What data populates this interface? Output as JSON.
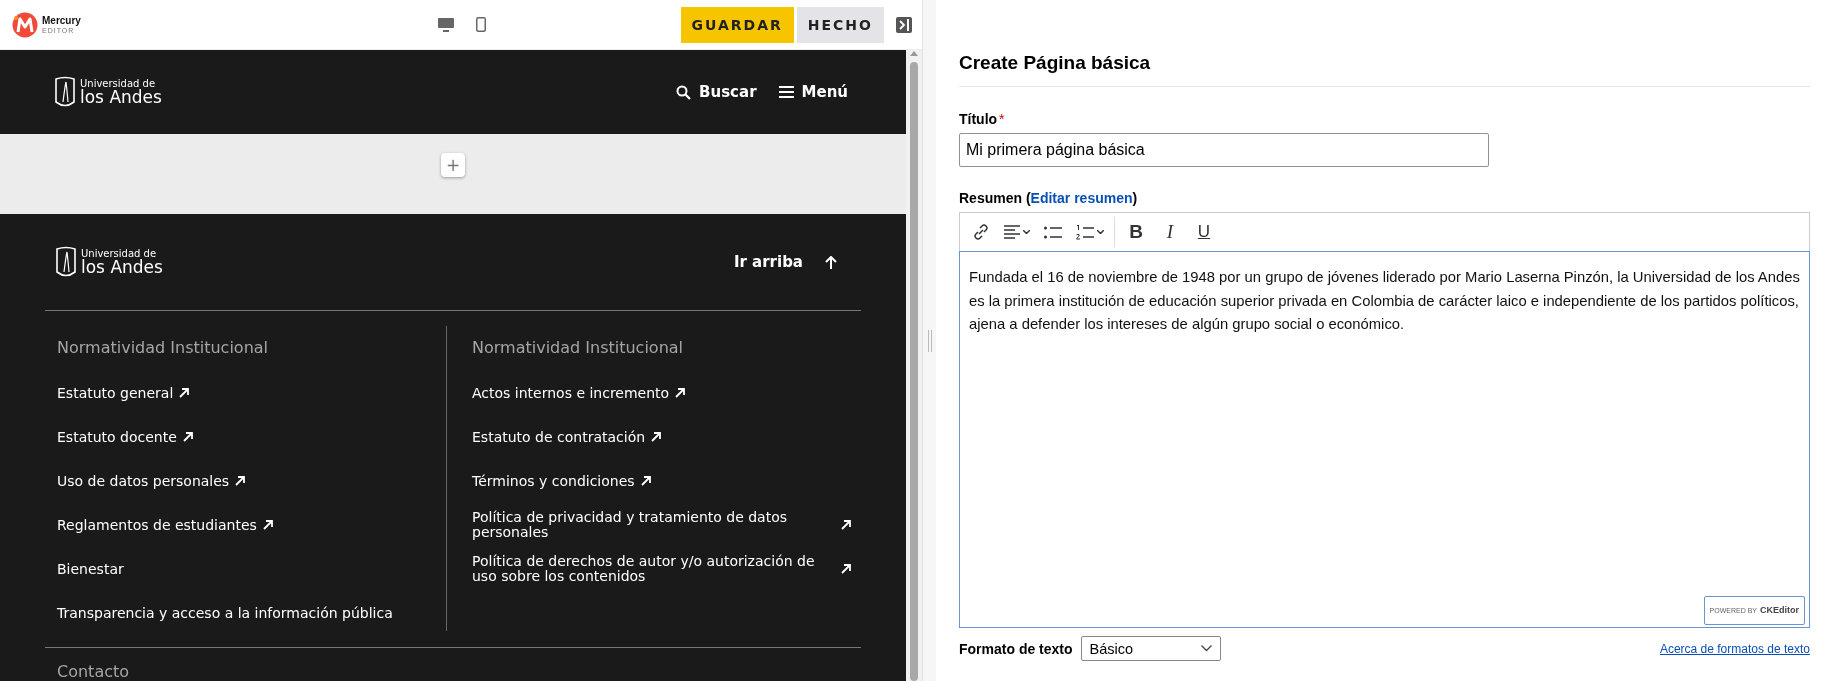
{
  "editor_bar": {
    "logo": {
      "name": "Mercury",
      "sub": "EDITOR"
    },
    "buttons": [
      {
        "label": "GUARDAR",
        "kind": "primary"
      },
      {
        "label": "HECHO",
        "kind": "secondary"
      }
    ]
  },
  "site": {
    "header": {
      "logo": {
        "line1": "Universidad de",
        "line2": "los Andes"
      },
      "nav": [
        {
          "label": "Buscar",
          "kind": "search"
        },
        {
          "label": "Menú",
          "kind": "menu"
        }
      ]
    },
    "add_section": {
      "label": "+"
    },
    "footer": {
      "logo": {
        "line1": "Universidad de",
        "line2": "los Andes"
      },
      "back_to_top": "Ir arriba",
      "columns": [
        {
          "heading": "Normatividad Institucional",
          "links": [
            {
              "label": "Estatuto general",
              "external": true
            },
            {
              "label": "Estatuto docente",
              "external": true
            },
            {
              "label": "Uso de datos personales",
              "external": true
            },
            {
              "label": "Reglamentos de estudiantes",
              "external": true
            },
            {
              "label": "Bienestar",
              "external": false
            },
            {
              "label": "Transparencia y acceso a la información pública",
              "external": false
            }
          ]
        },
        {
          "heading": "Normatividad Institucional",
          "links": [
            {
              "label": "Actos internos e incremento",
              "external": true
            },
            {
              "label": "Estatuto de contratación",
              "external": true
            },
            {
              "label": "Términos y condiciones",
              "external": true
            },
            {
              "label": "Política de privacidad y tratamiento de datos personales",
              "external": true
            },
            {
              "label": "Política de derechos de autor y/o autorización de uso sobre los contenidos",
              "external": true
            }
          ]
        }
      ],
      "contact_heading": "Contacto"
    }
  },
  "form": {
    "title": "Create Página básica",
    "title_field": {
      "label": "Título",
      "required_mark": "*",
      "value": "Mi primera página básica"
    },
    "summary": {
      "label_prefix": "Resumen (",
      "link": "Editar resumen",
      "label_suffix": ")"
    },
    "toolbar": [
      {
        "kind": "link"
      },
      {
        "kind": "align"
      },
      {
        "kind": "bullets"
      },
      {
        "kind": "numbers"
      },
      {
        "kind": "bold",
        "label": "B"
      },
      {
        "kind": "italic",
        "label": "I"
      },
      {
        "kind": "underline",
        "label": "U"
      }
    ],
    "body": "Fundada el 16 de noviembre de 1948 por un grupo de jóvenes liderado por Mario Laserna Pinzón, la Universidad de los Andes es la primera institución de educación superior privada en Colombia de carácter laico e independiente de los partidos políticos, ajena a defender los intereses de algún grupo social o económico.",
    "powered_by": {
      "prefix": "POWERED BY",
      "brand": "CKEditor"
    },
    "format": {
      "label": "Formato de texto",
      "value": "Básico",
      "help_link": "Acerca de formatos de texto"
    }
  }
}
